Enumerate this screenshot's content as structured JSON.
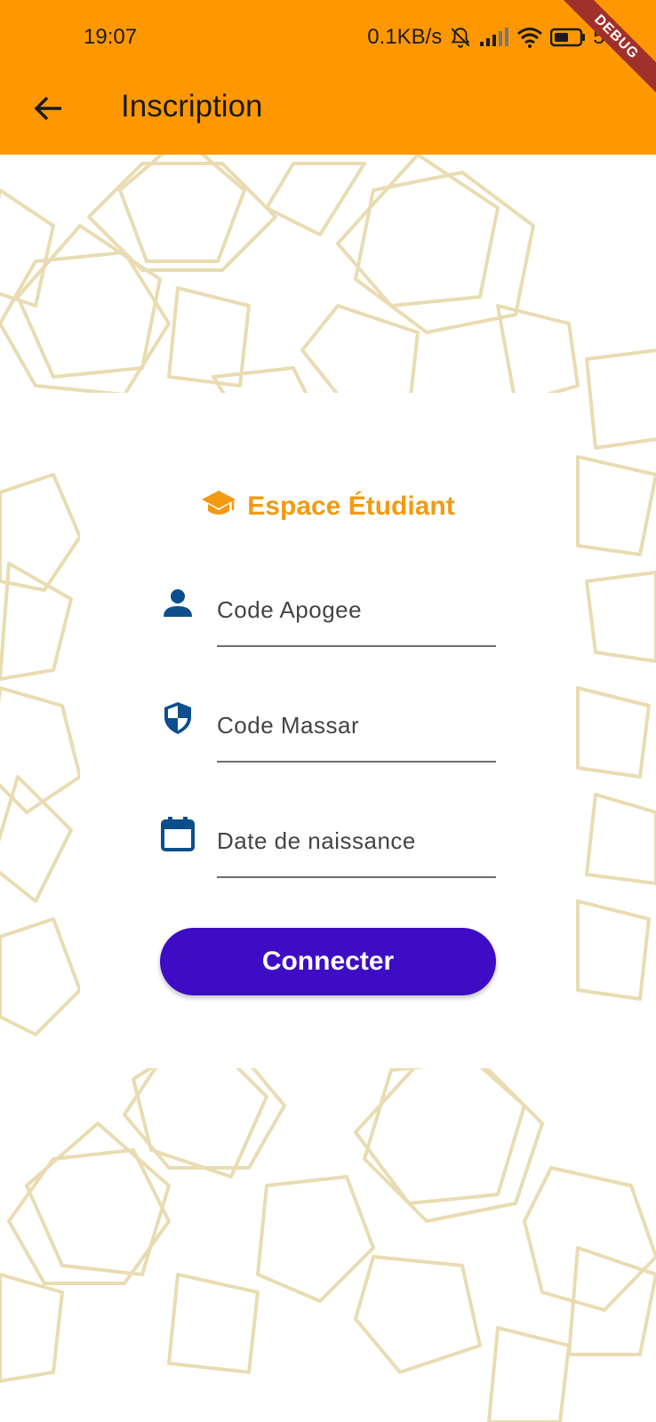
{
  "status_bar": {
    "time": "19:07",
    "network_speed": "0.1KB/s",
    "battery": "50"
  },
  "app_bar": {
    "title": "Inscription",
    "back_icon": "arrow-back-icon"
  },
  "debug_banner": "DEBUG",
  "card": {
    "title": "Espace Étudiant",
    "title_icon": "graduation-cap-icon",
    "fields": [
      {
        "icon": "person-icon",
        "placeholder": "Code Apogee"
      },
      {
        "icon": "shield-icon",
        "placeholder": "Code Massar"
      },
      {
        "icon": "calendar-icon",
        "placeholder": "Date de naissance"
      }
    ],
    "submit_label": "Connecter"
  },
  "colors": {
    "app_bar": "#ff9800",
    "accent_title": "#f39a12",
    "icon_blue": "#0d4f8c",
    "button": "#3d0cc4",
    "pattern": "#e9dcb2"
  }
}
